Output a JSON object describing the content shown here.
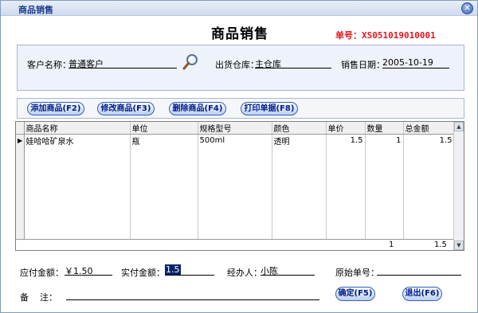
{
  "window": {
    "title": "商品销售",
    "close_glyph": "✕"
  },
  "header": {
    "title": "商品销售",
    "order_no": "单号：XS051019010001"
  },
  "info": {
    "customer_label": "客户名称：",
    "customer_value": "普通客户",
    "warehouse_label": "出货仓库：",
    "warehouse_value": "主仓库",
    "date_label": "销售日期：",
    "date_value": "2005-10-19"
  },
  "toolbar": {
    "add": "添加商品(F2)",
    "edit": "修改商品(F3)",
    "delete": "删除商品(F4)",
    "print": "打印单据(F8)"
  },
  "grid": {
    "columns": [
      "商品名称",
      "单位",
      "规格型号",
      "颜色",
      "单价",
      "数量",
      "总金额"
    ],
    "rows": [
      [
        "娃哈哈矿泉水",
        "瓶",
        "500ml",
        "透明",
        "1.5",
        "1",
        "1.5"
      ]
    ],
    "row_marker": "▶",
    "totals": {
      "quantity": "1",
      "amount": "1.5"
    }
  },
  "payment": {
    "payable_label": "应付金额：",
    "payable_value": "￥1.50",
    "paid_label": "实付金额：",
    "paid_value": "1.5",
    "handler_label": "经办人：",
    "handler_value": "小陈",
    "orig_label": "原始单号：",
    "orig_value": "",
    "note_label": "备    注：",
    "note_value": ""
  },
  "actions": {
    "ok": "确定(F5)",
    "exit": "退出(F6)"
  },
  "icons": {
    "search": "search-icon",
    "close": "close-icon"
  },
  "colors": {
    "order_no": "#e0161b",
    "button_text": "#001a8a",
    "panel_bg": "#eef2fb"
  }
}
